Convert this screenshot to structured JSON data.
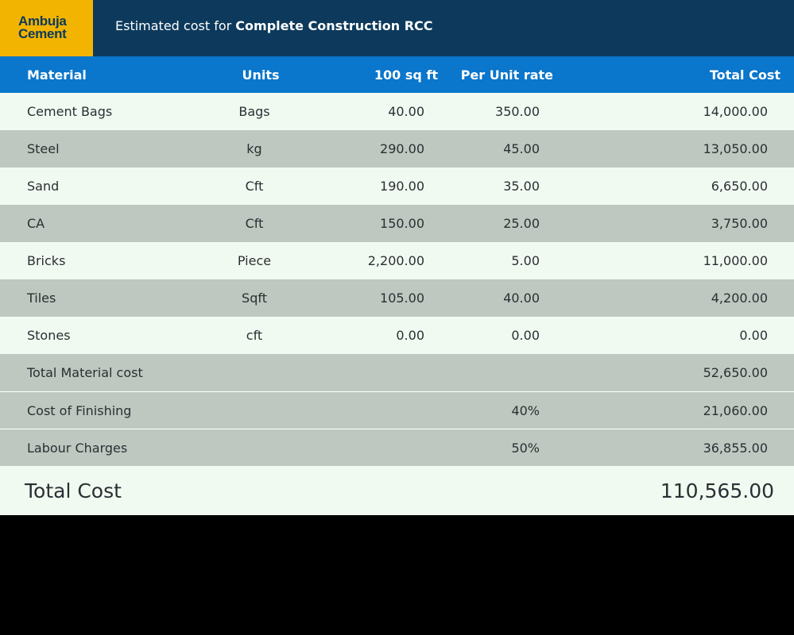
{
  "logo": {
    "line1": "Ambuja",
    "line2": "Cement"
  },
  "header": {
    "prefix": "Estimated cost for ",
    "emphasis": "Complete Construction RCC"
  },
  "columns": {
    "material": "Material",
    "units": "Units",
    "qty": "100 sq ft",
    "rate": "Per Unit rate",
    "total": "Total Cost"
  },
  "rows": [
    {
      "material": "Cement Bags",
      "units": "Bags",
      "qty": "40.00",
      "rate": "350.00",
      "total": "14,000.00"
    },
    {
      "material": "Steel",
      "units": "kg",
      "qty": "290.00",
      "rate": "45.00",
      "total": "13,050.00"
    },
    {
      "material": "Sand",
      "units": "Cft",
      "qty": "190.00",
      "rate": "35.00",
      "total": "6,650.00"
    },
    {
      "material": "CA",
      "units": "Cft",
      "qty": "150.00",
      "rate": "25.00",
      "total": "3,750.00"
    },
    {
      "material": "Bricks",
      "units": "Piece",
      "qty": "2,200.00",
      "rate": "5.00",
      "total": "11,000.00"
    },
    {
      "material": "Tiles",
      "units": "Sqft",
      "qty": "105.00",
      "rate": "40.00",
      "total": "4,200.00"
    },
    {
      "material": "Stones",
      "units": "cft",
      "qty": "0.00",
      "rate": "0.00",
      "total": "0.00"
    }
  ],
  "summary": [
    {
      "label": "Total Material cost",
      "rate": "",
      "total": "52,650.00"
    },
    {
      "label": "Cost of Finishing",
      "rate": "40%",
      "total": "21,060.00"
    },
    {
      "label": "Labour Charges",
      "rate": "50%",
      "total": "36,855.00"
    }
  ],
  "grand_total": {
    "label": "Total Cost",
    "value": "110,565.00"
  },
  "colors": {
    "header_bg": "#0d3a5c",
    "logo_bg": "#f2b400",
    "table_header_bg": "#0a76cc",
    "row_light": "#f1faf1",
    "row_dark": "#bec8c0"
  }
}
